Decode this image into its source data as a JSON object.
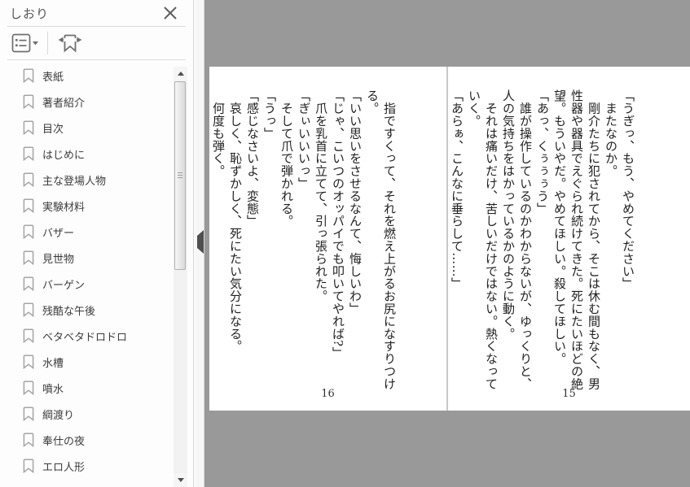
{
  "sidebar": {
    "title": "しおり",
    "toolbar": {
      "list_view_button": "list-view-options",
      "add_bookmark_button": "bookmark-with-arrows"
    },
    "icons": {
      "close": "x-mark",
      "item_bookmark": "ribbon-outline",
      "collapse": "left-triangle",
      "scroll_up": "up-triangle",
      "scroll_down": "down-triangle"
    },
    "items": [
      "表紙",
      "著者紹介",
      "目次",
      "はじめに",
      "主な登場人物",
      "実験材料",
      "バザー",
      "見世物",
      "バーゲン",
      "残酷な午後",
      "ベタベタドロドロ",
      "水槽",
      "噴水",
      "綱渡り",
      "奉仕の夜",
      "エロ人形"
    ]
  },
  "reader": {
    "pages": [
      {
        "number": "16",
        "paragraphs": [
          "　指ですくって、それを燃え上がるお尻になすりつける。",
          "「いい思いをさせるなんて、悔しいわ」",
          "「じゃ、こいつのオッパイでも叩いてやれば?」",
          "　爪を乳首に立てて、引っ張られた。",
          "「ぎぃいいいっ」",
          "　そして爪で弾かれる。",
          "「うっ」",
          "「感じなさいよ、変態」",
          "　哀しく、恥ずかしく、死にたい気分になる。",
          "　何度も弾く。"
        ]
      },
      {
        "number": "15",
        "paragraphs": [
          "「うぎっ、もう、やめてください」",
          "　またなのか。",
          "　剛介たちに犯されてから、そこは休む間もなく、男性器や器具でえぐられ続けてきた。死にたいほどの絶望。もういやだ。やめてほしい。殺してほしい。",
          "「あっ、くぅぅぅう」",
          "　誰が操作しているのかわからないが、ゆっくりと、人の気持ちをはかっているかのように動く。",
          "　それは痛いだけ、苦しいだけではない。熱くなっていく。",
          "「あらぁ、こんなに垂らして……」"
        ]
      }
    ]
  },
  "colors": {
    "canvas_gray": "#999999",
    "page_white": "#ffffff",
    "text": "#1f1f1f"
  }
}
